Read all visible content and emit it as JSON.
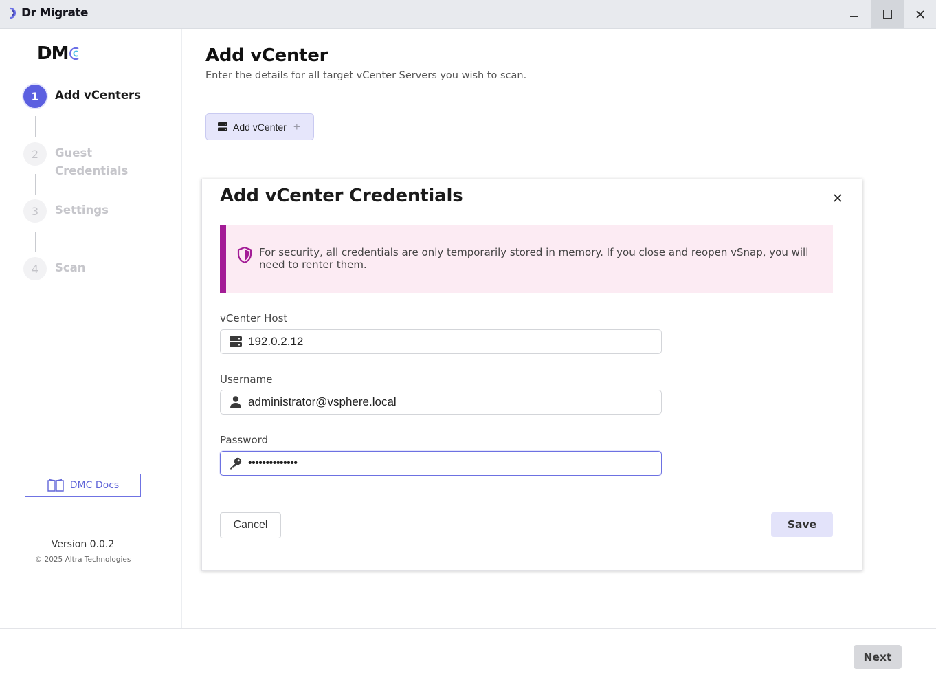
{
  "window": {
    "app_name": "Dr Migrate",
    "controls": {
      "minimize": "minimize-icon",
      "maximize": "maximize-icon",
      "close": "close-icon"
    }
  },
  "sidebar": {
    "logo_text": "DM",
    "steps": [
      {
        "number": "1",
        "label": "Add vCenters",
        "state": "active"
      },
      {
        "number": "2",
        "label": "Guest Credentials",
        "state": "pending"
      },
      {
        "number": "3",
        "label": "Settings",
        "state": "pending"
      },
      {
        "number": "4",
        "label": "Scan",
        "state": "pending"
      }
    ],
    "docs_label": "DMC Docs",
    "version": "Version 0.0.2",
    "copyright": "© 2025 Altra Technologies"
  },
  "main": {
    "title": "Add vCenter",
    "subtitle": "Enter the details for all target vCenter Servers you wish to scan.",
    "add_button_label": "Add vCenter"
  },
  "dialog": {
    "title": "Add vCenter Credentials",
    "notice": "For security, all credentials are only temporarily stored in memory. If you close and reopen vSnap, you will need to renter them.",
    "fields": {
      "host": {
        "label": "vCenter Host",
        "value": "192.0.2.12"
      },
      "username": {
        "label": "Username",
        "value": "administrator@vsphere.local"
      },
      "password": {
        "label": "Password",
        "value": "••••••••••••••"
      }
    },
    "cancel_label": "Cancel",
    "save_label": "Save"
  },
  "footer": {
    "next_label": "Next"
  },
  "colors": {
    "accent": "#5b5fe0",
    "notice_bar": "#a31c96",
    "notice_bg": "#fcebf3",
    "button_soft": "#e3e3fa"
  }
}
